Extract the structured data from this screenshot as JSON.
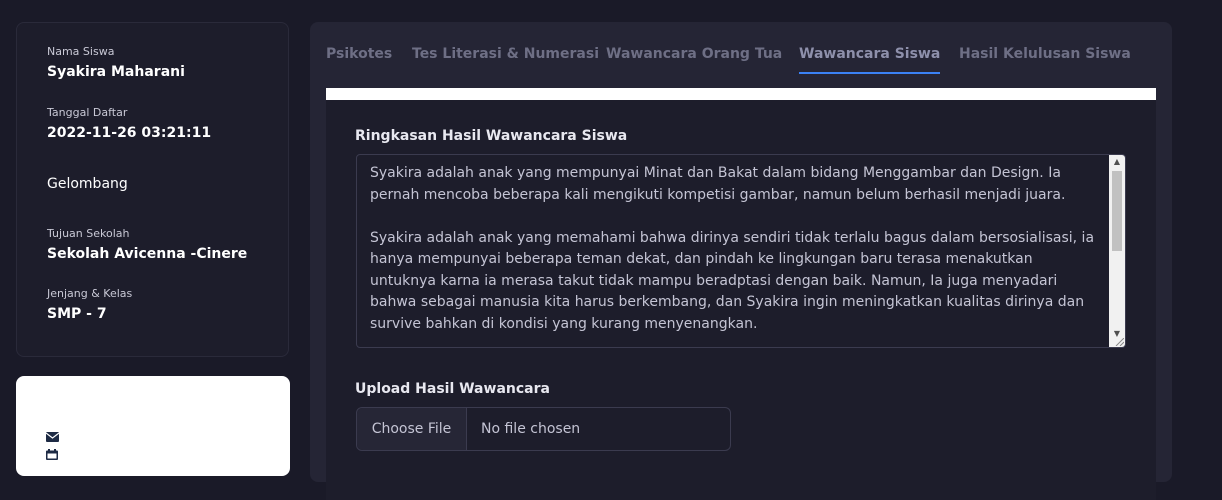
{
  "student": {
    "name_label": "Nama Siswa",
    "name": "Syakira Maharani",
    "registered_label": "Tanggal Daftar",
    "registered": "2022-11-26 03:21:11",
    "wave_label": "Gelombang",
    "school_label": "Tujuan Sekolah",
    "school": "Sekolah Avicenna -Cinere",
    "level_label": "Jenjang & Kelas",
    "level": "SMP - 7"
  },
  "contact_icons": [
    "envelope-icon",
    "calendar-icon"
  ],
  "tabs": [
    {
      "label": "Psikotes",
      "active": false
    },
    {
      "label": "Tes Literasi & Numerasi",
      "active": false
    },
    {
      "label": "Wawancara Orang Tua",
      "active": false
    },
    {
      "label": "Wawancara Siswa",
      "active": true
    },
    {
      "label": "Hasil Kelulusan Siswa",
      "active": false
    }
  ],
  "interview": {
    "summary_label": "Ringkasan Hasil Wawancara Siswa",
    "summary_text": "Syakira adalah anak yang mempunyai Minat dan Bakat dalam bidang Menggambar dan Design. Ia pernah mencoba beberapa kali mengikuti kompetisi gambar, namun belum berhasil menjadi juara.\n\nSyakira adalah anak yang memahami bahwa dirinya sendiri tidak terlalu bagus dalam bersosialisasi, ia hanya mempunyai beberapa teman dekat, dan pindah ke lingkungan baru terasa menakutkan untuknya karna ia merasa takut tidak mampu beradptasi dengan baik. Namun, Ia juga menyadari bahwa sebagai manusia kita harus berkembang, dan Syakira ingin meningkatkan kualitas dirinya dan survive bahkan di kondisi yang kurang menyenangkan.",
    "upload_label": "Upload Hasil Wawancara",
    "choose_file": "Choose File",
    "file_status": "No file chosen"
  },
  "colors": {
    "page_bg": "#1a1a28",
    "panel_bg": "#252535",
    "active_tab_underline": "#3b82f6",
    "inactive_tab": "#6e6f85"
  }
}
